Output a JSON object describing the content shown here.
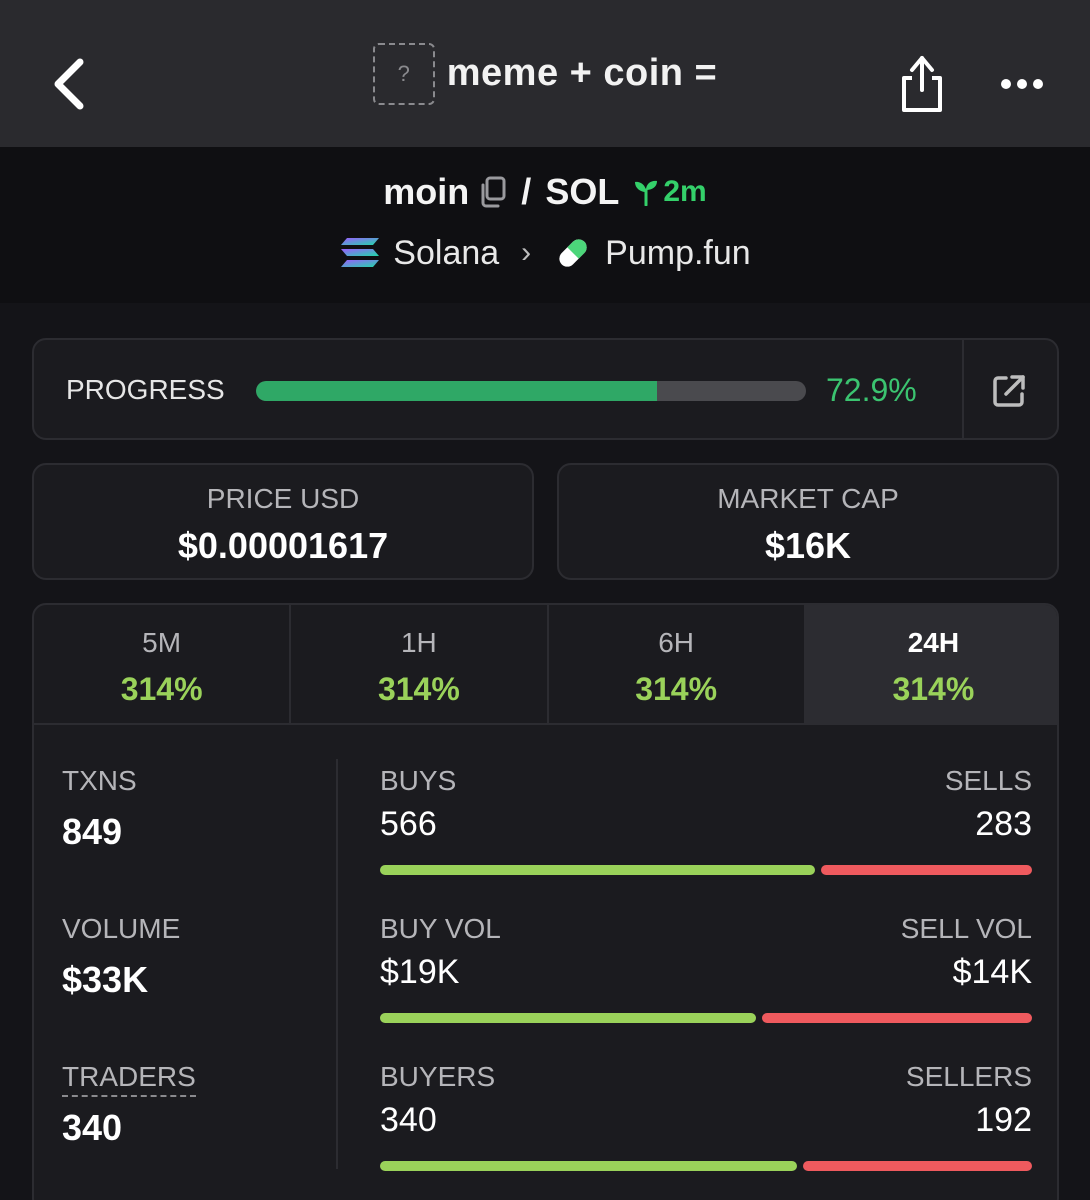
{
  "header": {
    "placeholder_icon_text": "?",
    "title": "meme + coin ="
  },
  "pair": {
    "token": "moin",
    "separator": "/",
    "quote": "SOL",
    "age": "2m",
    "chain": "Solana",
    "dex": "Pump.fun"
  },
  "progress": {
    "label": "PROGRESS",
    "percent_text": "72.9%",
    "percent": 72.9
  },
  "price": {
    "label": "PRICE USD",
    "value": "$0.00001617"
  },
  "market_cap": {
    "label": "MARKET CAP",
    "value": "$16K"
  },
  "timeframes": [
    {
      "label": "5M",
      "value": "314%"
    },
    {
      "label": "1H",
      "value": "314%"
    },
    {
      "label": "6H",
      "value": "314%"
    },
    {
      "label": "24H",
      "value": "314%",
      "active": true
    }
  ],
  "stats": {
    "txns": {
      "label": "TXNS",
      "value": "849"
    },
    "volume": {
      "label": "VOLUME",
      "value": "$33K"
    },
    "traders": {
      "label": "TRADERS",
      "value": "340"
    },
    "buys": {
      "label": "BUYS",
      "value": "566",
      "share": 0.667
    },
    "sells": {
      "label": "SELLS",
      "value": "283"
    },
    "buy_vol": {
      "label": "BUY VOL",
      "value": "$19K",
      "share": 0.576
    },
    "sell_vol": {
      "label": "SELL VOL",
      "value": "$14K"
    },
    "buyers": {
      "label": "BUYERS",
      "value": "340",
      "share": 0.639
    },
    "sellers": {
      "label": "SELLERS",
      "value": "192"
    }
  },
  "colors": {
    "accent_green": "#3bc470",
    "buy_green": "#9ad25a",
    "sell_red": "#ef5a5e",
    "progress_green": "#2fa866"
  }
}
